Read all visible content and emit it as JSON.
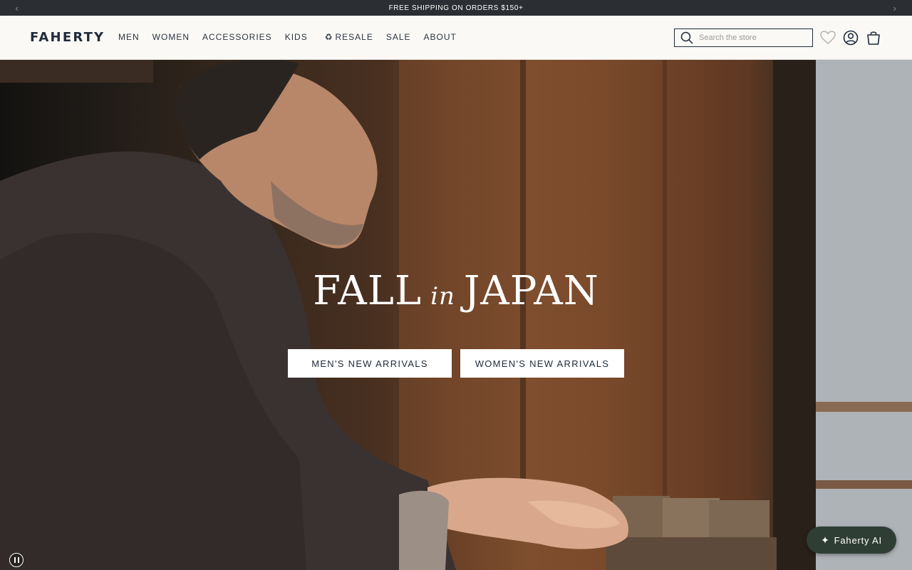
{
  "announcement": {
    "text": "FREE SHIPPING ON ORDERS $150+",
    "prev_icon": "chevron-left-icon",
    "next_icon": "chevron-right-icon"
  },
  "header": {
    "logo": "FAHERTY",
    "nav": {
      "men": "MEN",
      "women": "WOMEN",
      "accessories": "ACCESSORIES",
      "kids": "KIDS",
      "resale": "RESALE",
      "sale": "SALE",
      "about": "ABOUT"
    },
    "search": {
      "placeholder": "Search the store"
    },
    "icons": [
      "search-icon",
      "heart-icon",
      "account-icon",
      "bag-icon"
    ]
  },
  "hero": {
    "title_part1": "FALL",
    "title_part2": "in",
    "title_part3": "JAPAN",
    "cta_men": "MEN'S NEW ARRIVALS",
    "cta_women": "WOMEN'S NEW ARRIVALS"
  },
  "assistant": {
    "label": "Faherty AI"
  },
  "colors": {
    "announcement_bg": "#2b2e33",
    "header_bg": "#faf9f6",
    "brand_navy": "#1f2b3a",
    "ai_button_bg": "#2f3e35"
  }
}
